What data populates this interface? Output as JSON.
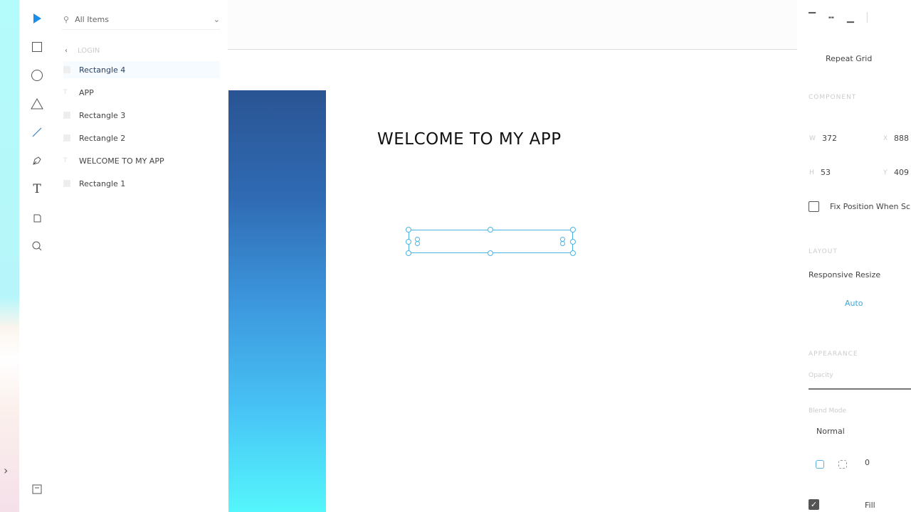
{
  "toolbar": {
    "tools": [
      "select",
      "rectangle",
      "ellipse",
      "polygon",
      "line",
      "pen",
      "text",
      "artboard",
      "zoom"
    ],
    "active": "select",
    "accent": "#1a8ee8"
  },
  "layers": {
    "search_placeholder": "All Items",
    "breadcrumb": "LOGIN",
    "items": [
      {
        "label": "Rectangle 4",
        "type": "rect"
      },
      {
        "label": "APP",
        "type": "text"
      },
      {
        "label": "Rectangle 3",
        "type": "rect"
      },
      {
        "label": "Rectangle 2",
        "type": "rect"
      },
      {
        "label": "WELCOME TO MY APP",
        "type": "text"
      },
      {
        "label": "Rectangle 1",
        "type": "rect"
      }
    ]
  },
  "canvas": {
    "heading": "WELCOME TO MY APP",
    "selection_color": "#4ab3e6"
  },
  "inspector": {
    "repeat_grid": "Repeat Grid",
    "component_label": "COMPONENT",
    "w_label": "W",
    "w": "372",
    "x_label": "X",
    "x": "888",
    "h_label": "H",
    "h": "53",
    "y_label": "Y",
    "y": "409",
    "fix_position": "Fix Position When Scr",
    "layout_label": "LAYOUT",
    "responsive_resize": "Responsive Resize",
    "auto": "Auto",
    "appearance_label": "APPEARANCE",
    "opacity_label": "Opacity",
    "blend_mode_label": "Blend Mode",
    "blend_mode": "Normal",
    "corner_radius": "0",
    "fill_label": "Fill",
    "fill_checked": true
  }
}
